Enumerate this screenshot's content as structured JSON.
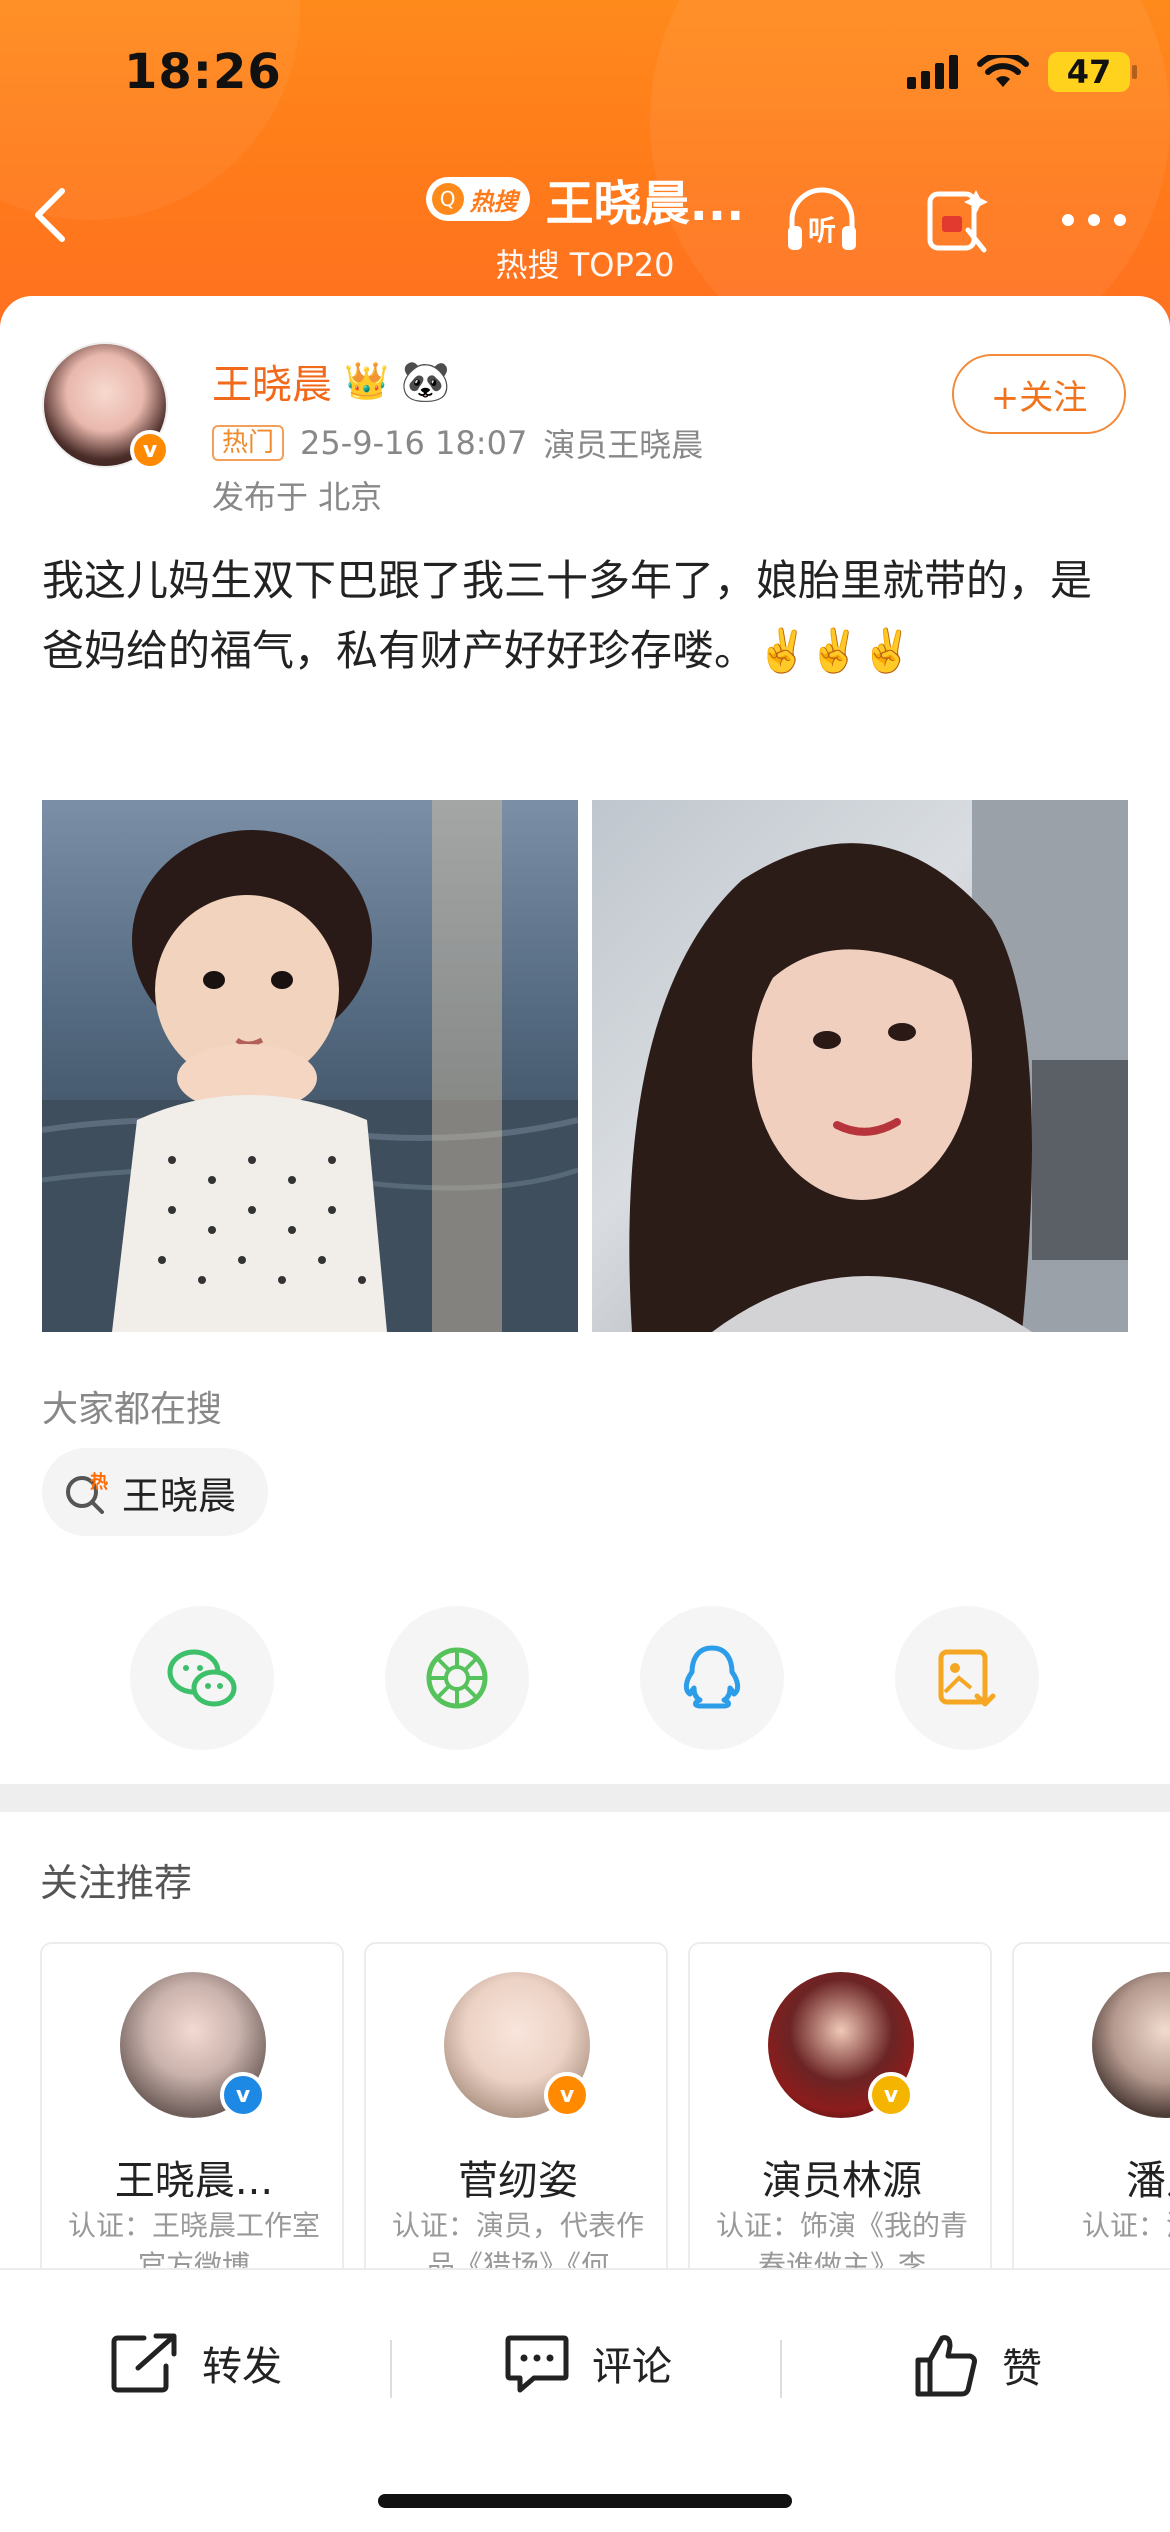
{
  "status": {
    "time": "18:26",
    "battery": "47"
  },
  "nav": {
    "hot_badge": "热搜",
    "title": "王晓晨...",
    "subtitle": "热搜 TOP20",
    "listen_label": "听"
  },
  "post": {
    "author": "王晓晨",
    "tag": "热门",
    "datetime": "25-9-16 18:07",
    "source": "演员王晓晨",
    "location": "发布于 北京",
    "follow_label": "+关注",
    "text": "我这儿妈生双下巴跟了我三十多年了，娘胎里就带的，是爸妈给的福气，私有财产好好珍存喽。✌️✌️✌️",
    "emoji_after_name": "🐼",
    "crown": "👑"
  },
  "search": {
    "label": "大家都在搜",
    "chip": "王晓晨",
    "chip_icon": "热"
  },
  "share": {
    "items": [
      "wechat-icon",
      "moments-icon",
      "qq-icon",
      "save-image-icon"
    ]
  },
  "recommend": {
    "title": "关注推荐",
    "cards": [
      {
        "name": "王晓晨...",
        "desc": "认证：王晓晨工作室官方微博",
        "badge": "v"
      },
      {
        "name": "菅纫姿",
        "desc": "认证：演员，代表作品《猎场》《何",
        "badge": "v"
      },
      {
        "name": "演员林源",
        "desc": "认证：饰演《我的青春谁做主》李",
        "badge": "v"
      },
      {
        "name": "潘之",
        "desc": "认证：潘之琳",
        "badge": "v"
      }
    ]
  },
  "actions": {
    "repost": "转发",
    "comment": "评论",
    "like": "赞"
  },
  "colors": {
    "brand_orange": "#ff7a1a",
    "name_orange": "#f16a1b"
  }
}
